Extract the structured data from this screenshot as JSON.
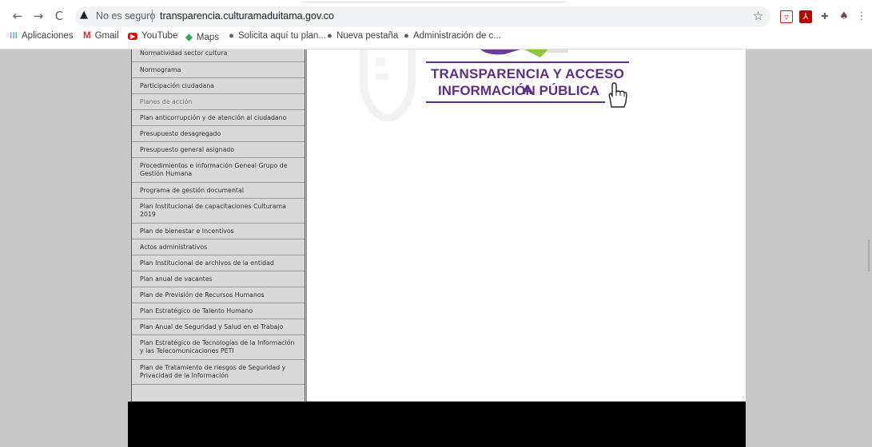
{
  "browser": {
    "security_label": "No es seguro",
    "url": "transparencia.culturamaduitama.gov.co",
    "icons": [
      "back-icon",
      "forward-icon",
      "reload-icon",
      "warning-icon",
      "star-icon",
      "extension-icon",
      "profile-icon",
      "menu-icon"
    ]
  },
  "bookmarks": [
    {
      "label": "Aplicaciones",
      "icon": "apps-icon"
    },
    {
      "label": "Gmail",
      "icon": "gmail-icon"
    },
    {
      "label": "YouTube",
      "icon": "youtube-icon"
    },
    {
      "label": "Maps",
      "icon": "maps-icon"
    },
    {
      "label": "Solicita aquí tu plan...",
      "icon": "globe-icon"
    },
    {
      "label": "Nueva pestaña",
      "icon": "globe-icon"
    },
    {
      "label": "Administración de c...",
      "icon": "globe-icon"
    }
  ],
  "sidebar": {
    "items": [
      {
        "label": "Normatividad sector cultura"
      },
      {
        "label": "Normograma"
      },
      {
        "label": "Participación ciudadana"
      },
      {
        "label": "Planes de acción"
      },
      {
        "label": "Plan anticorrupción y de atención al ciudadano"
      },
      {
        "label": "Presupuesto desagregado"
      },
      {
        "label": "Presupuesto general asignado"
      },
      {
        "label": "Procedimientos e información Geneal Grupo de Gestión Humana"
      },
      {
        "label": "Programa de gestión documental"
      },
      {
        "label": "Plan Institucional de capacitaciones Culturama 2019"
      },
      {
        "label": "Plan de bienestar e Incentivos"
      },
      {
        "label": "Actos administrativos"
      },
      {
        "label": "Plan Institucional de archivos de la entidad"
      },
      {
        "label": "Plan anual de vacantes"
      },
      {
        "label": "Plan de Previsión de Recursos Humanos"
      },
      {
        "label": "Plan Estratégico de Talento Humano"
      },
      {
        "label": "Plan Anual de Seguridad y Salud en el Trabajo"
      },
      {
        "label": "Plan Estratégico de Tecnologías de la Información y las Telecomunicaciones PETI"
      },
      {
        "label": "Plan de Tratamiento de riesgos de Seguridad y Privacidad de la Información"
      }
    ]
  },
  "banner": {
    "line1": "TRANSPARENCIA Y ACCESO A",
    "line2": "INFORMACIÓN PÚBLICA",
    "color": "#5c2e8a"
  }
}
